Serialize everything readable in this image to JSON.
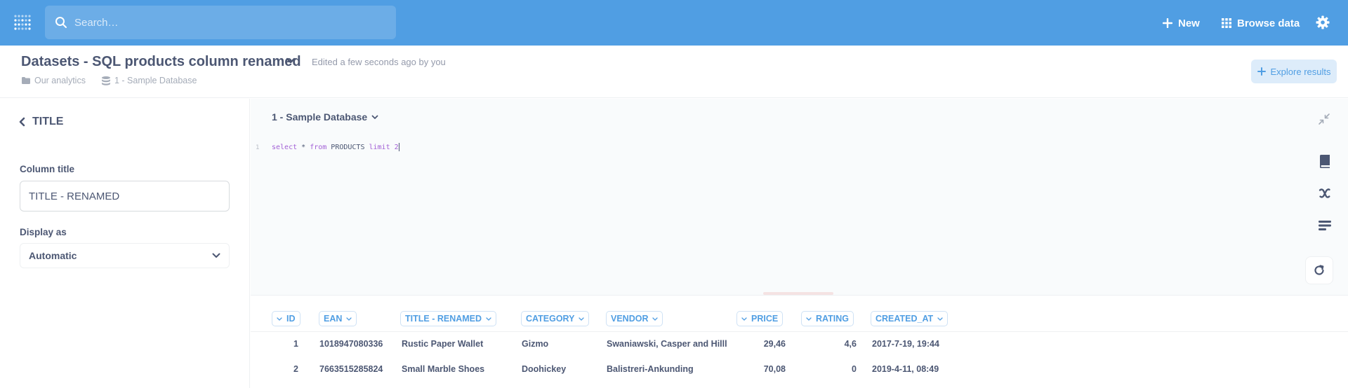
{
  "nav": {
    "search_placeholder": "Search…",
    "new_label": "New",
    "browse_label": "Browse data"
  },
  "header": {
    "title": "Datasets - SQL products column renamed",
    "edited": "Edited a few seconds ago by you",
    "collection": "Our analytics",
    "database": "1 - Sample Database",
    "explore_label": "Explore results"
  },
  "sidebar": {
    "column_name": "TITLE",
    "column_title_label": "Column title",
    "column_title_value": "TITLE - RENAMED",
    "display_as_label": "Display as",
    "display_as_value": "Automatic"
  },
  "editor": {
    "database": "1 - Sample Database",
    "line_number": "1",
    "query": {
      "kw1": "select",
      "star": " * ",
      "kw2": "from",
      "table": " PRODUCTS ",
      "kw3": "limit",
      "space": " ",
      "num": "2"
    }
  },
  "table": {
    "columns": [
      "ID",
      "EAN",
      "TITLE - RENAMED",
      "CATEGORY",
      "VENDOR",
      "PRICE",
      "RATING",
      "CREATED_AT"
    ],
    "rows": [
      [
        "1",
        "1018947080336",
        "Rustic Paper Wallet",
        "Gizmo",
        "Swaniawski, Casper and Hilll",
        "29,46",
        "4,6",
        "2017-7-19, 19:44"
      ],
      [
        "2",
        "7663515285824",
        "Small Marble Shoes",
        "Doohickey",
        "Balistreri-Ankunding",
        "70,08",
        "0",
        "2019-4-11, 08:49"
      ]
    ]
  },
  "colors": {
    "brand": "#509ee3",
    "text": "#4c5773",
    "muted": "#949aab",
    "keyword": "#a260d6"
  }
}
